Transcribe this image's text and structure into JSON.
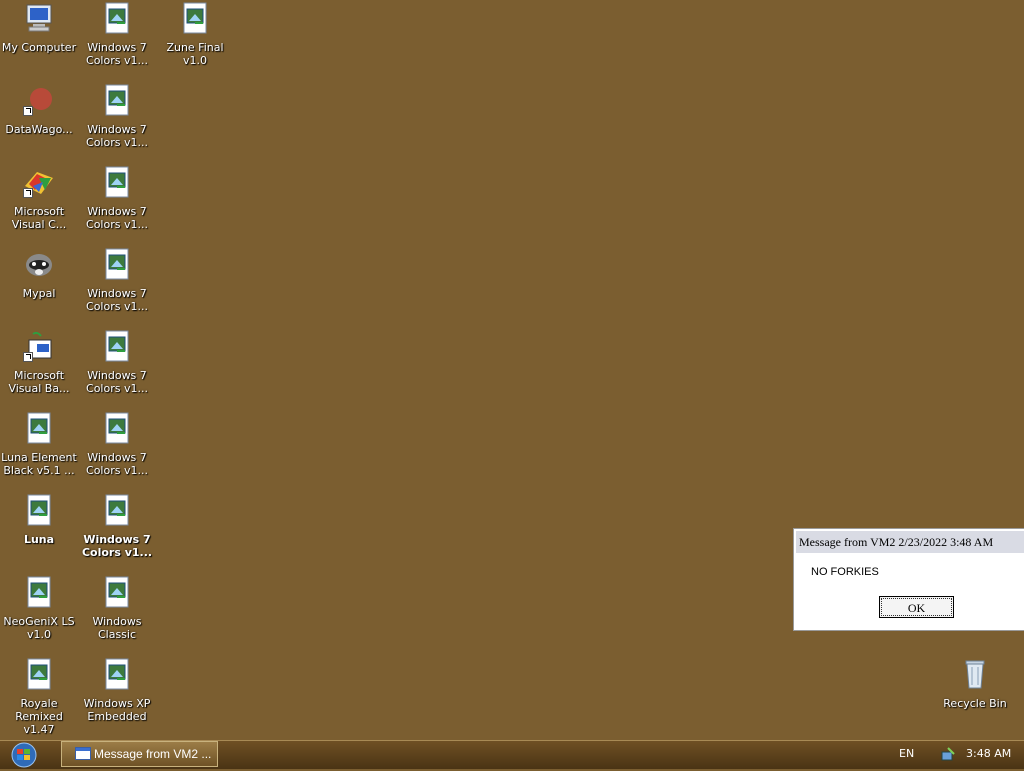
{
  "desktop": {
    "icons": [
      {
        "label": "My Computer",
        "icon": "my-computer-icon"
      },
      {
        "label": "Windows 7 Colors v1...",
        "icon": "theme-file-icon"
      },
      {
        "label": "Zune Final v1.0",
        "icon": "theme-file-icon"
      },
      {
        "label": "DataWago...",
        "icon": "datawagon-icon"
      },
      {
        "label": "Windows 7 Colors v1...",
        "icon": "theme-file-icon"
      },
      {
        "label": "Microsoft Visual C...",
        "icon": "visual-c-icon"
      },
      {
        "label": "Windows 7 Colors v1...",
        "icon": "theme-file-icon"
      },
      {
        "label": "Mypal",
        "icon": "mypal-raccoon-icon"
      },
      {
        "label": "Windows 7 Colors v1...",
        "icon": "theme-file-icon"
      },
      {
        "label": "Microsoft Visual Ba...",
        "icon": "visual-basic-icon"
      },
      {
        "label": "Windows 7 Colors v1...",
        "icon": "theme-file-icon"
      },
      {
        "label": "Luna Element Black v5.1 ...",
        "icon": "theme-file-icon"
      },
      {
        "label": "Windows 7 Colors v1...",
        "icon": "theme-file-icon"
      },
      {
        "label": "Luna",
        "icon": "theme-file-icon"
      },
      {
        "label": "Windows 7 Colors v1...",
        "icon": "theme-file-icon"
      },
      {
        "label": "NeoGeniX LS v1.0",
        "icon": "theme-file-icon"
      },
      {
        "label": "Windows Classic",
        "icon": "theme-file-icon"
      },
      {
        "label": "Royale Remixed v1.47",
        "icon": "theme-file-icon"
      },
      {
        "label": "Windows XP Embedded",
        "icon": "theme-file-icon"
      },
      {
        "label": "Recycle Bin",
        "icon": "recycle-bin-icon"
      }
    ]
  },
  "dialog": {
    "title": "Message from VM2 2/23/2022 3:48 AM",
    "message": "NO FORKIES",
    "ok_label": "OK"
  },
  "taskbar": {
    "task_label": "Message from VM2 ...",
    "language": "EN",
    "clock": "3:48 AM"
  },
  "colors": {
    "desktop_bg": "#7b5e30",
    "taskbar": "#5a4019"
  }
}
